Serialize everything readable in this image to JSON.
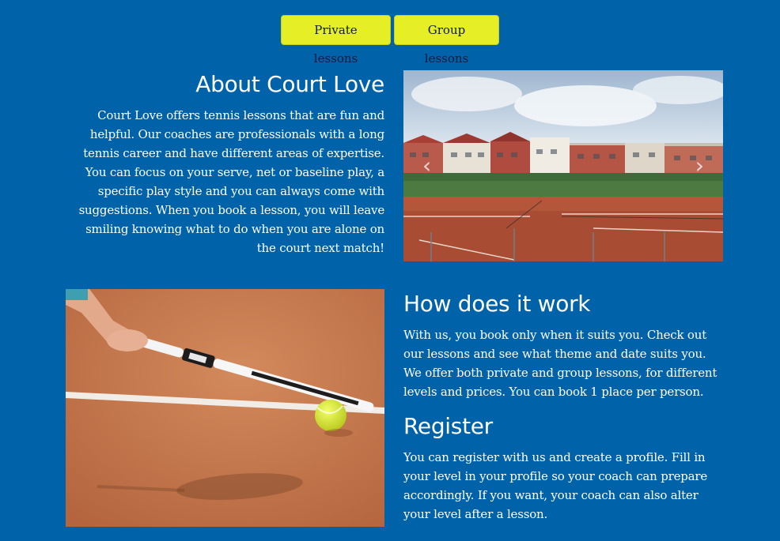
{
  "nav": {
    "buttons": [
      {
        "label": "Private lessons"
      },
      {
        "label": "Group lessons"
      }
    ]
  },
  "about": {
    "title": "About Court Love",
    "body": "Court Love offers tennis lessons that are fun and helpful. Our coaches are professionals with a long tennis career and have different areas of expertise. You can focus on your serve, net or baseline play, a specific play style and you can always come with suggestions. When you book a lesson, you will leave smiling knowing what to do when you are alone on the court next match!"
  },
  "how": {
    "title": "How does it work",
    "body": "With us, you book only when it suits you. Check out our lessons and see what theme and date suits you. We offer both private and group lessons, for different levels and prices. You can book 1 place per person."
  },
  "register": {
    "title": "Register",
    "body": "You can register with us and create a profile. Fill in your level in your profile so your coach can prepare accordingly. If you want, your coach can also alter your level after a lesson."
  },
  "images": {
    "village": {
      "icon": "tennis-club-photo"
    },
    "racket": {
      "icon": "racket-and-ball-photo"
    }
  },
  "carousel": {
    "prev_icon": "chevron-left-icon",
    "next_icon": "chevron-right-icon",
    "prev_glyph": "‹",
    "next_glyph": "›"
  },
  "colors": {
    "background": "#0062a8",
    "button": "#e6ef26",
    "text": "#ffffff"
  }
}
